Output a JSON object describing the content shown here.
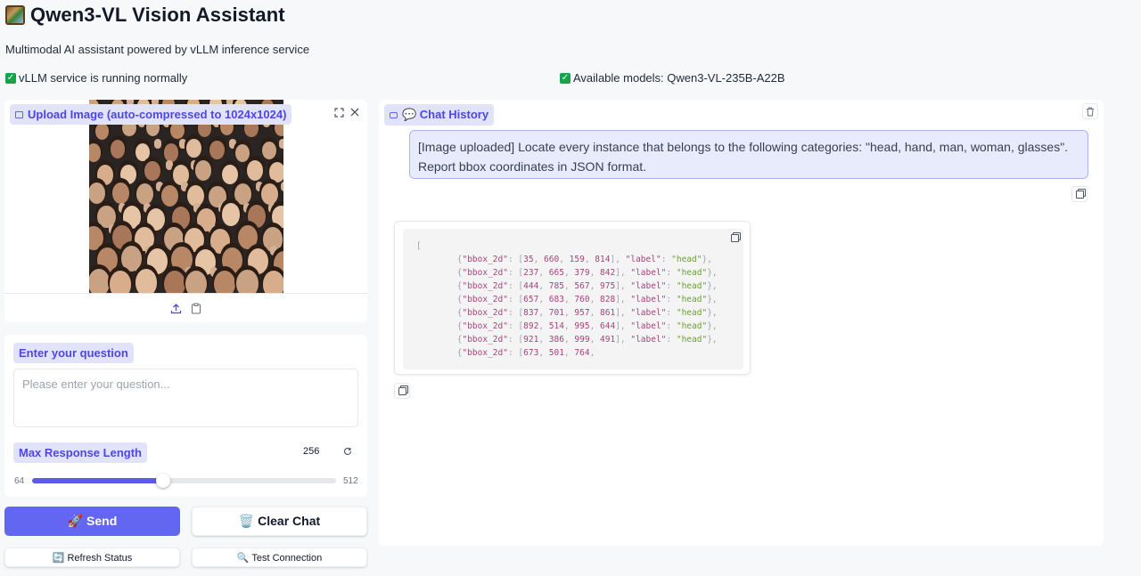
{
  "app": {
    "title": "Qwen3-VL Vision Assistant",
    "subtitle": "Multimodal AI assistant powered by vLLM inference service",
    "status_service": "vLLM service is running normally",
    "status_models": "Available models: Qwen3-VL-235B-A22B"
  },
  "upload": {
    "label": "Upload Image (auto-compressed to 1024x1024)",
    "icons": [
      "image-icon",
      "fullscreen-icon",
      "close-icon",
      "upload-icon",
      "clipboard-icon"
    ]
  },
  "question": {
    "label": "Enter your question",
    "placeholder": "Please enter your question..."
  },
  "max_length": {
    "label": "Max Response Length",
    "value": "256",
    "min_label": "64",
    "max_label": "512",
    "fraction": 0.43
  },
  "buttons": {
    "send": "🚀 Send",
    "clear": "🗑️ Clear Chat",
    "refresh": "🔄 Refresh Status",
    "test": "🔍 Test Connection"
  },
  "chat": {
    "label": "💬 Chat History",
    "user_message": "[Image uploaded] Locate every instance that belongs to the following categories: \"head, hand, man, woman, glasses\". Report bbox coordinates in JSON format.",
    "bot_code_open": "[",
    "bot_rows": [
      {
        "bbox": [
          "35",
          "660",
          "159",
          "814"
        ],
        "label": "head"
      },
      {
        "bbox": [
          "237",
          "665",
          "379",
          "842"
        ],
        "label": "head"
      },
      {
        "bbox": [
          "444",
          "785",
          "567",
          "975"
        ],
        "label": "head"
      },
      {
        "bbox": [
          "657",
          "683",
          "760",
          "828"
        ],
        "label": "head"
      },
      {
        "bbox": [
          "837",
          "701",
          "957",
          "861"
        ],
        "label": "head"
      },
      {
        "bbox": [
          "892",
          "514",
          "995",
          "644"
        ],
        "label": "head"
      },
      {
        "bbox": [
          "921",
          "386",
          "999",
          "491"
        ],
        "label": "head"
      }
    ],
    "bot_partial_bbox": [
      "673",
      "501",
      "764"
    ],
    "key_bbox": "\"bbox_2d\"",
    "key_label": "\"label\""
  },
  "colors": {
    "accent": "#6366f1",
    "chip_bg": "#e0e3fb",
    "chip_text": "#4f46e5",
    "status_ok": "#16a34a",
    "user_bubble": "#e8ebfb"
  }
}
